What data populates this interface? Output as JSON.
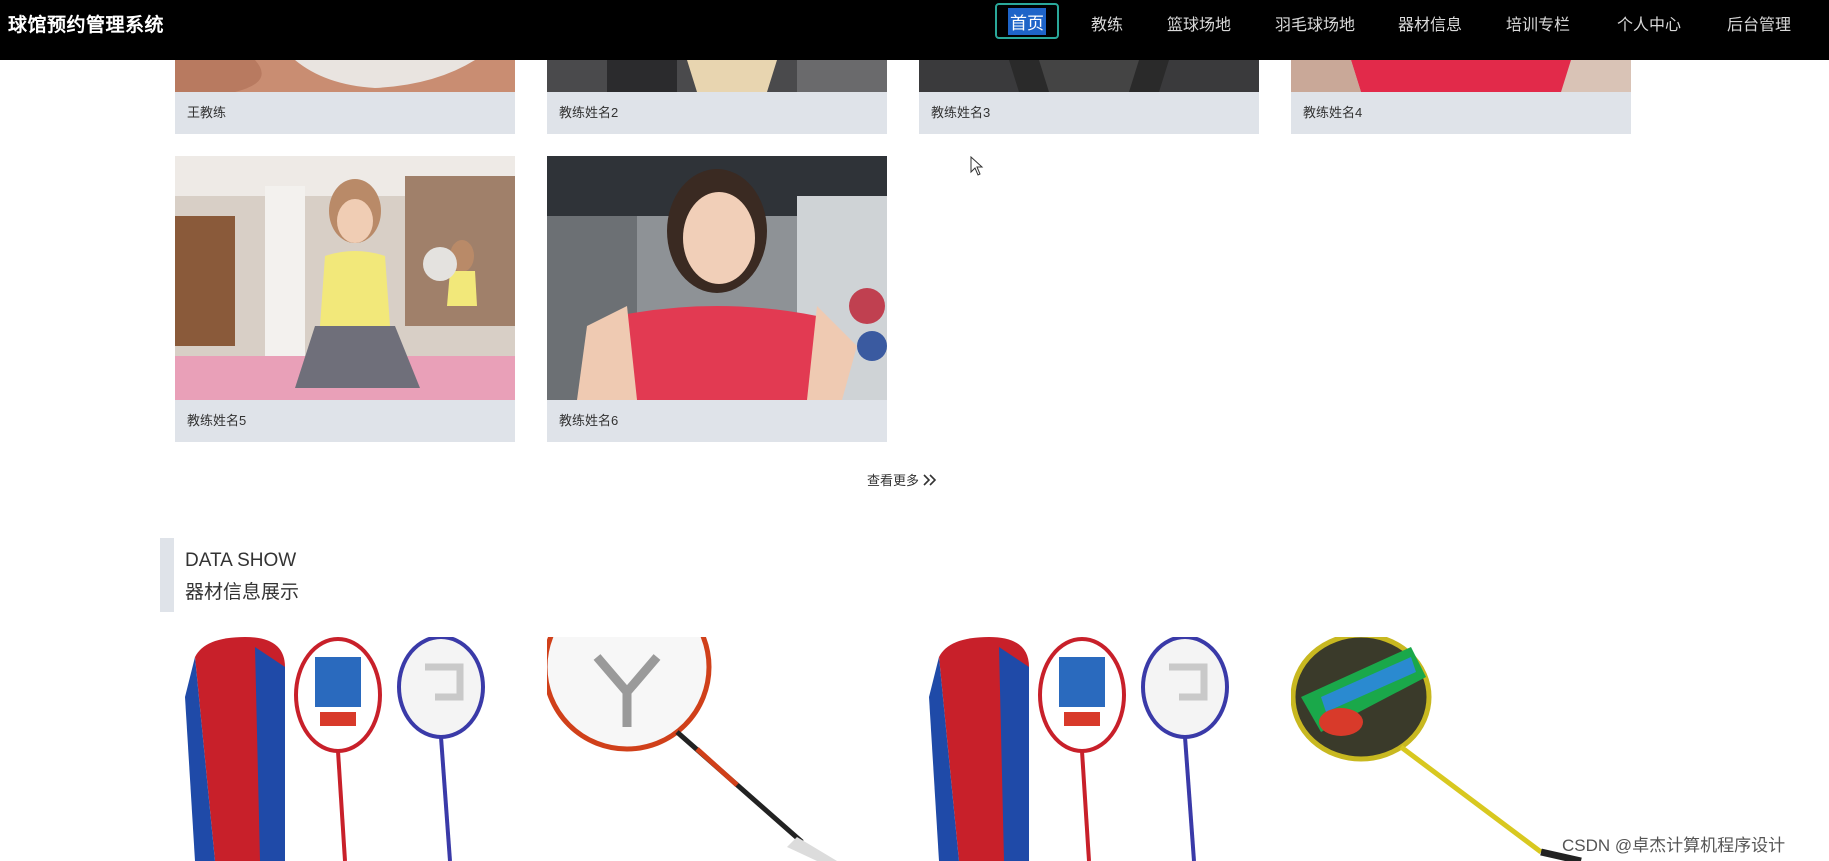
{
  "nav": {
    "brand": "球馆预约管理系统",
    "home": "首页",
    "items": [
      "教练",
      "篮球场地",
      "羽毛球场地",
      "器材信息",
      "培训专栏",
      "个人中心",
      "后台管理"
    ]
  },
  "coaches": {
    "names": [
      "王教练",
      "教练姓名2",
      "教练姓名3",
      "教练姓名4",
      "教练姓名5",
      "教练姓名6"
    ],
    "more": "查看更多"
  },
  "section": {
    "title_en": "DATA SHOW",
    "title_cn": "器材信息展示"
  },
  "watermark": "CSDN @卓杰计算机程序设计",
  "colors": {
    "nav_bg": "#000000",
    "home_border": "#2aa89a",
    "home_highlight": "#1e64c8",
    "caption_bg": "#dfe3e9"
  }
}
